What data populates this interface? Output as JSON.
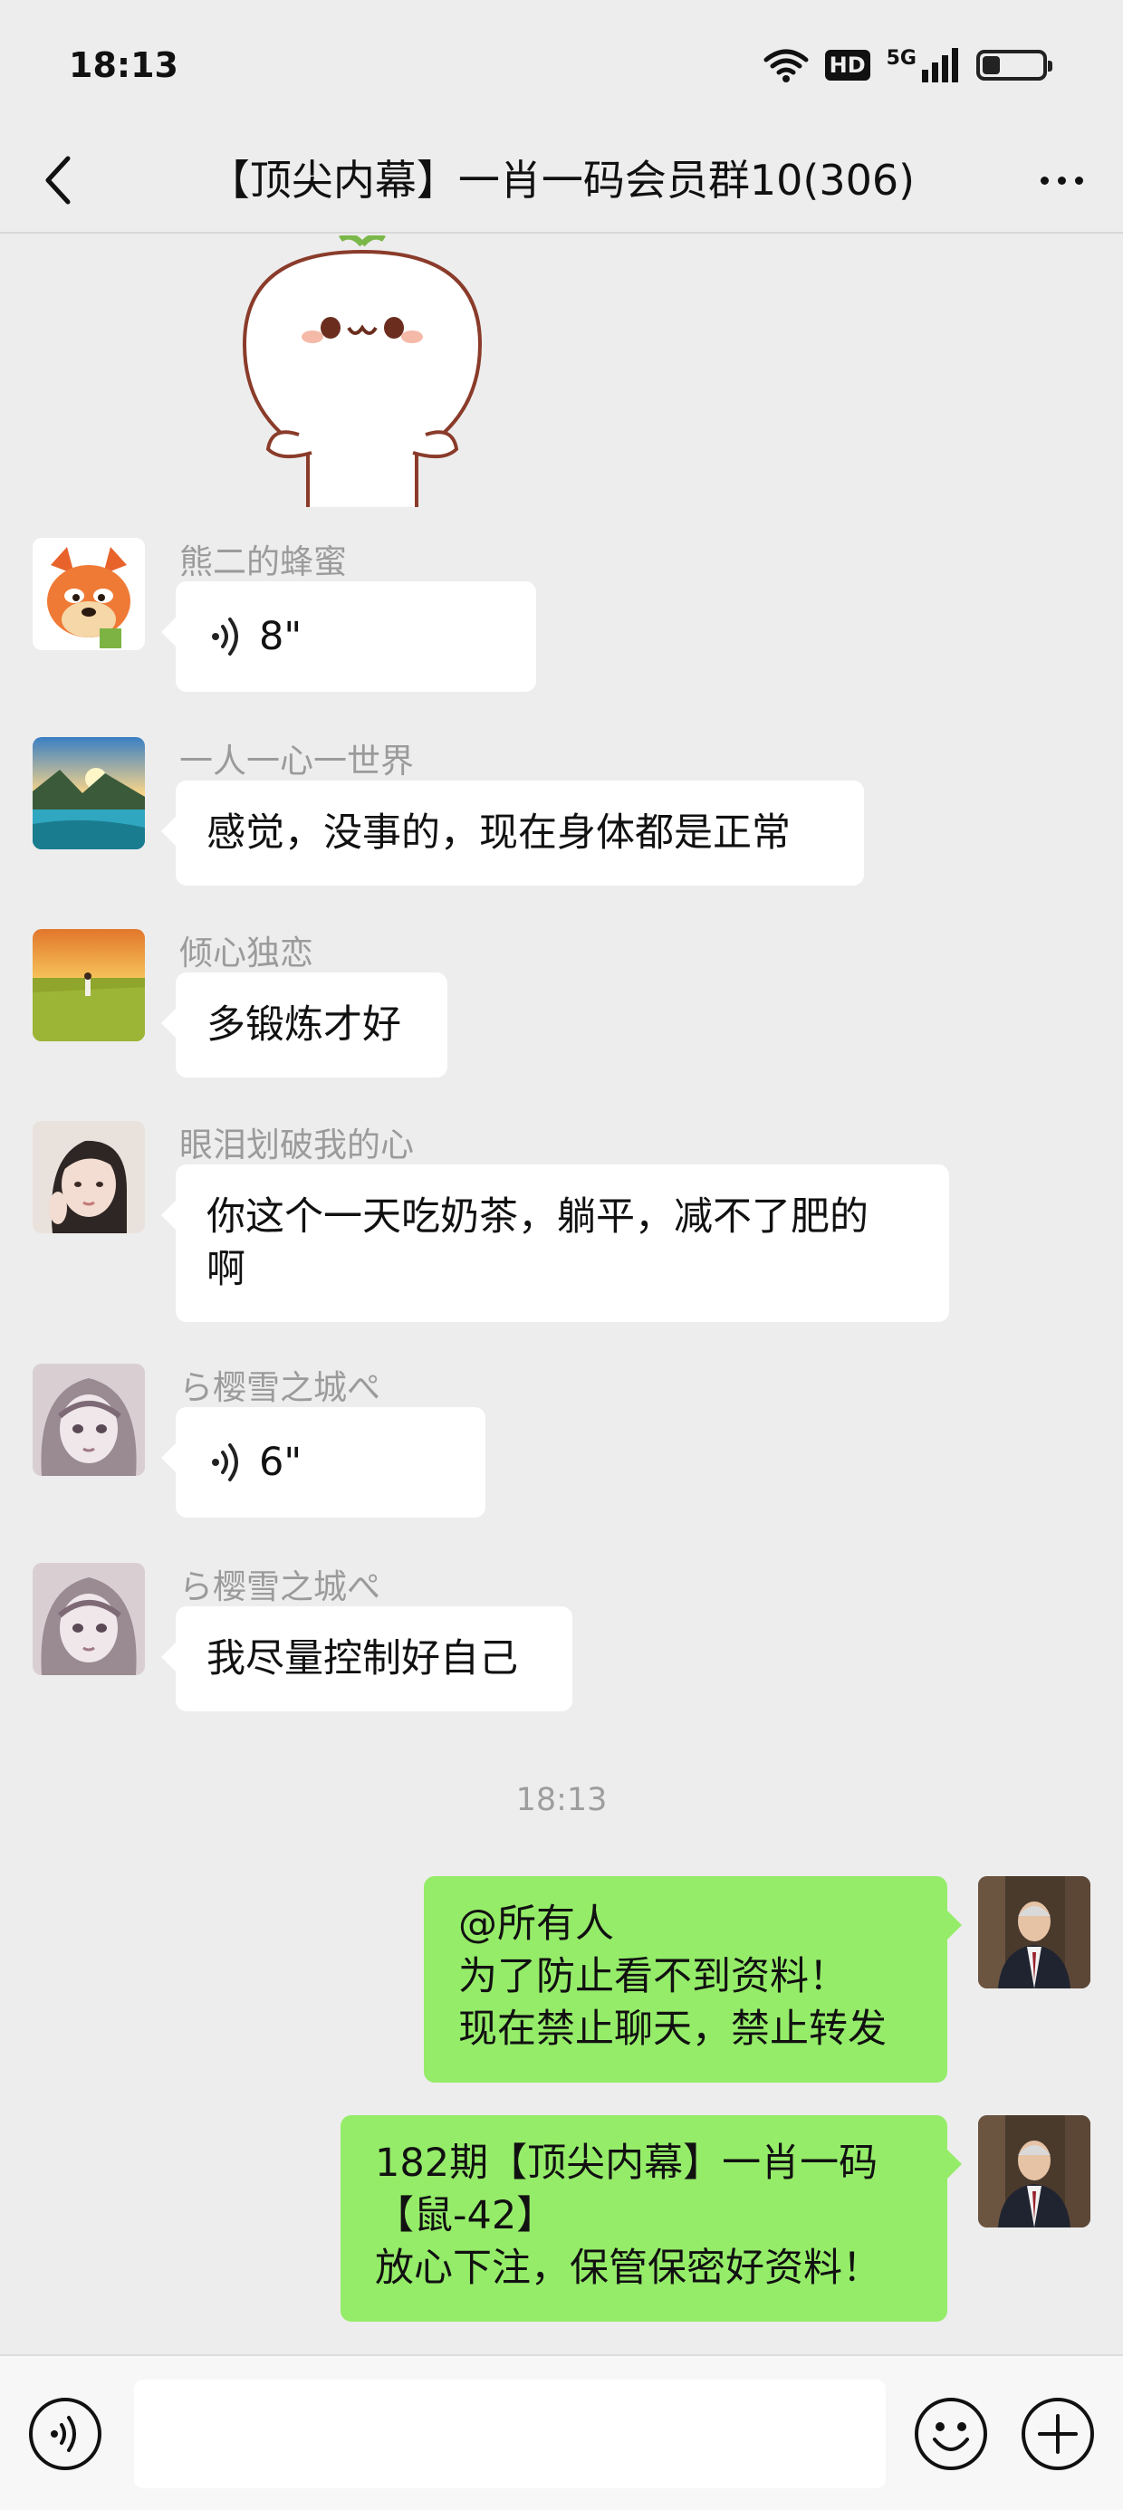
{
  "status": {
    "time": "18:13",
    "hd_label": "HD",
    "network_label": "5G",
    "battery_level": 0.3
  },
  "header": {
    "title": "【顶尖内幕】一肖一码会员群10(306)"
  },
  "messages": [
    {
      "sender": "熊二的蜂蜜",
      "type": "voice",
      "duration": "8\"",
      "avatar": "fox-avatar"
    },
    {
      "sender": "一人一心一世界",
      "type": "text",
      "text": "感觉，没事的，现在身体都是正常",
      "avatar": "lake-avatar"
    },
    {
      "sender": "倾心独恋",
      "type": "text",
      "text": "多锻炼才好",
      "avatar": "field-avatar"
    },
    {
      "sender": "眼泪划破我的心",
      "type": "text",
      "lines": [
        "你这个一天吃奶茶，躺平，减不了肥的",
        "啊"
      ],
      "avatar": "girl-avatar"
    },
    {
      "sender": "ら樱雪之城ぺ",
      "type": "voice",
      "duration": "6\"",
      "avatar": "sketch-avatar"
    },
    {
      "sender": "ら樱雪之城ぺ",
      "type": "text",
      "text": "我尽量控制好自己",
      "avatar": "sketch-avatar"
    }
  ],
  "timestamp": "18:13",
  "my_messages": [
    {
      "lines": [
        "@所有人",
        "为了防止看不到资料！",
        "现在禁止聊天，禁止转发"
      ]
    },
    {
      "lines": [
        "182期【顶尖内幕】一肖一码",
        "【鼠-42】",
        "放心下注，保管保密好资料！"
      ]
    }
  ],
  "colors": {
    "background": "#ededed",
    "my_bubble": "#95ec69",
    "other_bubble": "#ffffff",
    "sender_name": "#9b9b9b"
  }
}
